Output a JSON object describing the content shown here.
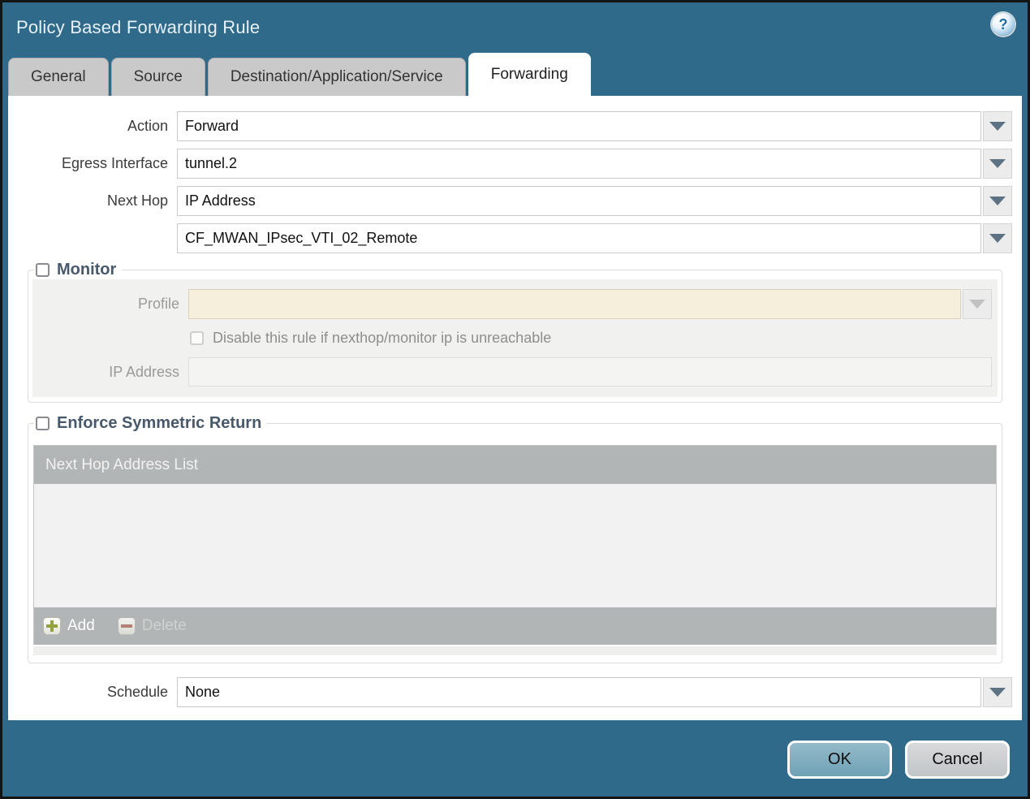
{
  "window": {
    "title": "Policy Based Forwarding Rule",
    "help_icon": "?"
  },
  "tabs": [
    {
      "label": "General",
      "active": false
    },
    {
      "label": "Source",
      "active": false
    },
    {
      "label": "Destination/Application/Service",
      "active": false
    },
    {
      "label": "Forwarding",
      "active": true
    }
  ],
  "form": {
    "action": {
      "label": "Action",
      "value": "Forward"
    },
    "egress_interface": {
      "label": "Egress Interface",
      "value": "tunnel.2"
    },
    "next_hop": {
      "label": "Next Hop",
      "value": "IP Address"
    },
    "next_hop_address": {
      "label": "",
      "value": "CF_MWAN_IPsec_VTI_02_Remote"
    },
    "schedule": {
      "label": "Schedule",
      "value": "None"
    }
  },
  "monitor": {
    "title": "Monitor",
    "checked": false,
    "profile": {
      "label": "Profile",
      "value": ""
    },
    "disable_rule": {
      "label": "Disable this rule if nexthop/monitor ip is unreachable",
      "checked": false
    },
    "ip_address": {
      "label": "IP Address",
      "value": ""
    }
  },
  "enforce_symmetric_return": {
    "title": "Enforce Symmetric Return",
    "checked": false,
    "table": {
      "header": "Next Hop Address List",
      "rows": []
    },
    "add_button": "Add",
    "delete_button": "Delete"
  },
  "footer": {
    "ok_button": "OK",
    "cancel_button": "Cancel"
  },
  "colors": {
    "titlebar": "#2F6A8A",
    "tab_inactive": "#C9C9C9",
    "table_header": "#B1B5B5",
    "ok_button": "#6FA2B6",
    "cancel_button": "#C2C5C7",
    "disabled_field": "#F5EFDB",
    "legend_text": "#47596A"
  }
}
